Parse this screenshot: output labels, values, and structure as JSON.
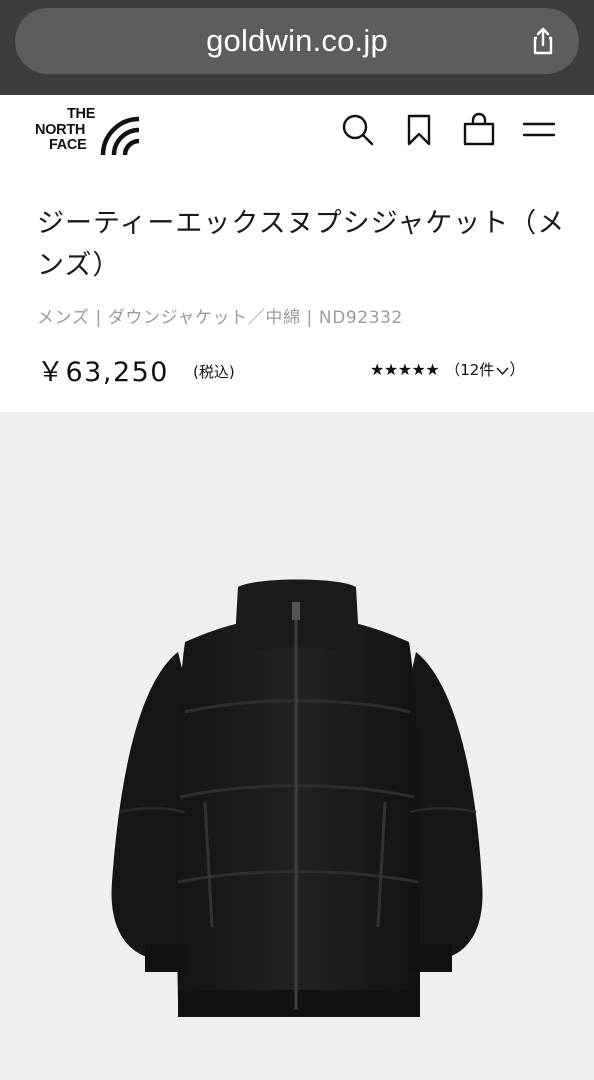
{
  "browser": {
    "url": "goldwin.co.jp",
    "share_icon": "share-icon"
  },
  "header": {
    "logo": {
      "line1": "THE",
      "line2": "NORTH",
      "line3": "FACE"
    },
    "icons": [
      "search-icon",
      "bookmark-icon",
      "cart-icon",
      "menu-icon"
    ]
  },
  "product": {
    "title": "ジーティーエックスヌプシジャケット（メンズ）",
    "category": "メンズ | ダウンジャケット／中綿 | ND92332",
    "price": "￥63,250",
    "tax_label": "(税込)",
    "rating": {
      "stars": "★★★★★",
      "score": 5,
      "max": 5,
      "review_count_label": "（12件"
    },
    "image_alt": "black down jacket"
  },
  "colors": {
    "chrome_bg": "#3b3d3f",
    "urlbar_bg": "#5b5d60",
    "image_bg": "#efefef",
    "category_text": "#9b9b9b"
  }
}
